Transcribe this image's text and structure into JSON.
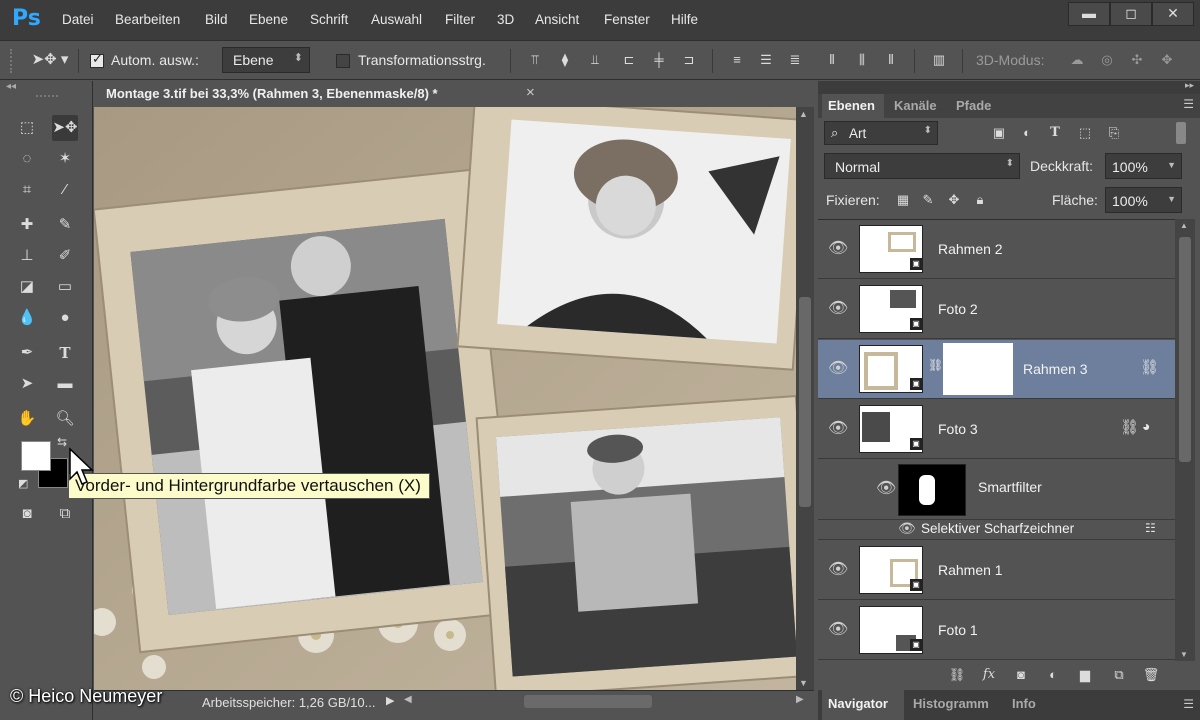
{
  "app": {
    "logo": "Ps"
  },
  "menu": [
    "Datei",
    "Bearbeiten",
    "Bild",
    "Ebene",
    "Schrift",
    "Auswahl",
    "Filter",
    "3D",
    "Ansicht",
    "Fenster",
    "Hilfe"
  ],
  "window_controls": {
    "minimize": "▬",
    "maximize": "◻",
    "close": "✕"
  },
  "options": {
    "auto_select_label": "Autom. ausw.:",
    "auto_select_checked": true,
    "auto_select_value": "Ebene",
    "transform_label": "Transformationsstrg.",
    "transform_checked": false,
    "mode3d_label": "3D-Modus:"
  },
  "document": {
    "tab_title": "Montage 3.tif bei 33,3% (Rahmen 3, Ebenenmaske/8) *",
    "tab_close": "×"
  },
  "status": {
    "text": "Arbeitsspeicher: 1,26 GB/10..."
  },
  "tooltip": "Vorder- und Hintergrundfarbe vertauschen (X)",
  "watermark": "© Heico Neumeyer",
  "layers_panel": {
    "tabs": [
      "Ebenen",
      "Kanäle",
      "Pfade"
    ],
    "filter_kind": "Art",
    "blend_mode": "Normal",
    "opacity_label": "Deckkraft:",
    "opacity_value": "100%",
    "lock_label": "Fixieren:",
    "fill_label": "Fläche:",
    "fill_value": "100%",
    "layers": [
      {
        "name": "Rahmen 2",
        "selected": false
      },
      {
        "name": "Foto 2",
        "selected": false
      },
      {
        "name": "Rahmen 3",
        "selected": true
      },
      {
        "name": "Foto 3",
        "selected": false
      },
      {
        "name": "Smartfilter",
        "selected": false
      },
      {
        "name": "Selektiver Scharfzeichner",
        "selected": false
      },
      {
        "name": "Rahmen 1",
        "selected": false
      },
      {
        "name": "Foto 1",
        "selected": false
      }
    ]
  },
  "bottom_tabs": [
    "Navigator",
    "Histogramm",
    "Info"
  ],
  "colors": {
    "accent": "#31a8ff",
    "selected_row": "#6d7f9c",
    "panel": "#535353",
    "menubar": "#3c3c3c",
    "tooltip_bg": "#fcfccb"
  }
}
